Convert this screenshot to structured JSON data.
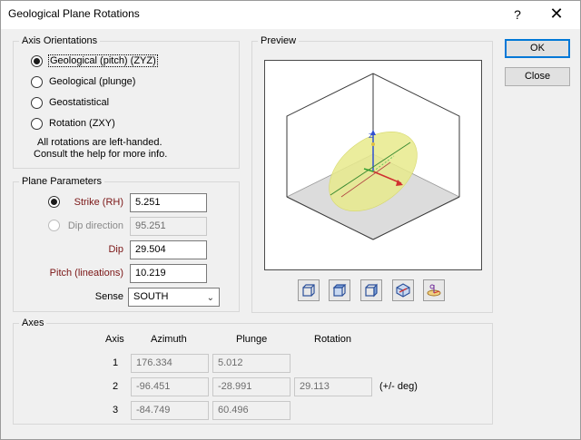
{
  "window": {
    "title": "Geological Plane Rotations",
    "help_glyph": "?",
    "close_glyph": "✕"
  },
  "axis_orientations": {
    "legend": "Axis Orientations",
    "options": [
      {
        "label": "Geological (pitch) (ZYZ)",
        "selected": true
      },
      {
        "label": "Geological (plunge)",
        "selected": false
      },
      {
        "label": "Geostatistical",
        "selected": false
      },
      {
        "label": "Rotation (ZXY)",
        "selected": false
      }
    ],
    "note_line1": "All rotations are left-handed.",
    "note_line2": "Consult the help for more info."
  },
  "plane_parameters": {
    "legend": "Plane Parameters",
    "strike_label": "Strike (RH)",
    "strike_value": "5.251",
    "dip_direction_label": "Dip direction",
    "dip_direction_value": "95.251",
    "dip_label": "Dip",
    "dip_value": "29.504",
    "pitch_label": "Pitch (lineations)",
    "pitch_value": "10.219",
    "sense_label": "Sense",
    "sense_value": "SOUTH"
  },
  "preview": {
    "legend": "Preview",
    "axis_z_label": "Z",
    "view_buttons": [
      "view-front-icon",
      "view-top-icon",
      "view-side-icon",
      "view-rotate-icon",
      "view-reset-icon"
    ]
  },
  "axes": {
    "legend": "Axes",
    "headers": {
      "axis": "Axis",
      "azimuth": "Azimuth",
      "plunge": "Plunge",
      "rotation": "Rotation"
    },
    "rows": [
      {
        "axis": "1",
        "azimuth": "176.334",
        "plunge": "5.012",
        "rotation": ""
      },
      {
        "axis": "2",
        "azimuth": "-96.451",
        "plunge": "-28.991",
        "rotation": "29.113"
      },
      {
        "axis": "3",
        "azimuth": "-84.749",
        "plunge": "60.496",
        "rotation": ""
      }
    ],
    "rotation_unit": "(+/- deg)"
  },
  "buttons": {
    "ok": "OK",
    "close": "Close"
  },
  "colors": {
    "required_label": "#7a1515",
    "default_button_border": "#0078d7",
    "plane_fill": "#e8ea8c"
  }
}
